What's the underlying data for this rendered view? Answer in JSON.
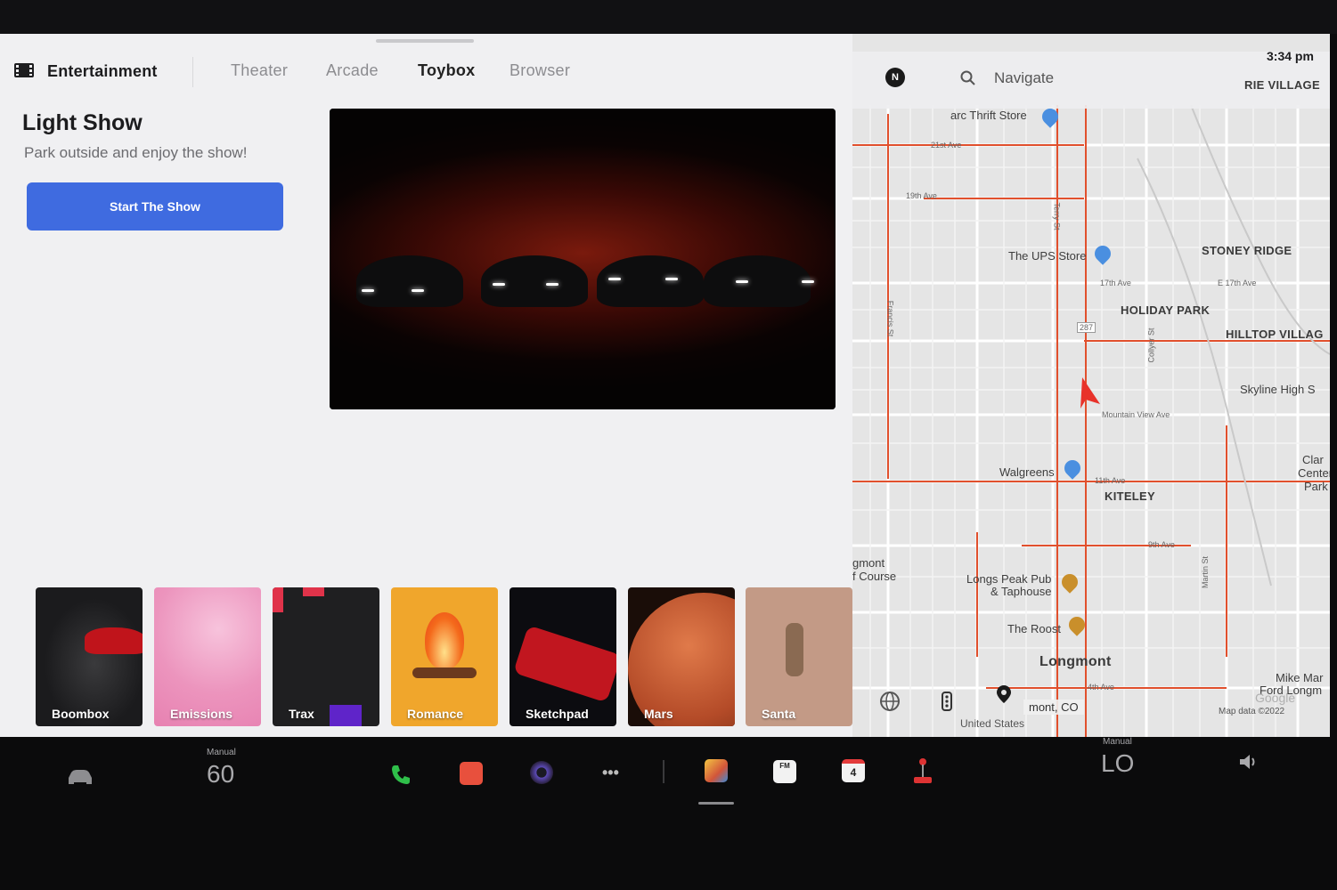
{
  "header": {
    "app_title": "Entertainment",
    "tabs": [
      {
        "label": "Theater",
        "active": false
      },
      {
        "label": "Arcade",
        "active": false
      },
      {
        "label": "Toybox",
        "active": true
      },
      {
        "label": "Browser",
        "active": false
      }
    ]
  },
  "feature": {
    "title": "Light Show",
    "subtitle": "Park outside and enjoy the show!",
    "button_label": "Start The Show"
  },
  "tiles": [
    {
      "label": "Boombox",
      "color": "#1b1b1d"
    },
    {
      "label": "Emissions",
      "color": "#f09cc0"
    },
    {
      "label": "Trax",
      "color": "#222224"
    },
    {
      "label": "Romance",
      "color": "#f2a82a"
    },
    {
      "label": "Sketchpad",
      "color": "#0c0c10"
    },
    {
      "label": "Mars",
      "color": "#3a1a12"
    },
    {
      "label": "Santa",
      "color": "#c59a85"
    }
  ],
  "map": {
    "compass_label": "N",
    "search_placeholder": "Navigate",
    "time": "3:34 pm",
    "places": {
      "prairie_village": "RIE VILLAGE",
      "stoney_ridge": "STONEY RIDGE",
      "holiday_park": "HOLIDAY PARK",
      "hilltop_village": "HILLTOP VILLAG",
      "kiteley": "KITELEY",
      "longmont": "Longmont"
    },
    "pois": {
      "thrift": "arc Thrift Store",
      "ups": "The UPS Store",
      "skyline": "Skyline High S",
      "walgreens": "Walgreens",
      "longs_peak_1": "Longs Peak Pub",
      "longs_peak_2": "& Taphouse",
      "roost": "The Roost",
      "golf_1": "gmont",
      "golf_2": "f Course",
      "clark_1": "Clar",
      "clark_2": "Center",
      "clark_3": "Park",
      "mike_1": "Mike Mar",
      "mike_2": "Ford Longm"
    },
    "streets": {
      "s21": "21st Ave",
      "s19": "19th Ave",
      "s17": "17th Ave",
      "e17": "E 17th Ave",
      "mountain_view": "Mountain View Ave",
      "s11": "11th Ave",
      "s9": "9th Ave",
      "s4": "4th Ave",
      "terry": "Terry St",
      "francis": "Francis St",
      "collyer": "Collyer St",
      "martin": "Martin St",
      "hwy": "287"
    },
    "location_chip": "mont, CO",
    "country": "United States",
    "attribution": "Map data ©2022",
    "google": "Google"
  },
  "taskbar": {
    "left_mode": "Manual",
    "left_temp": "60",
    "right_mode": "Manual",
    "right_temp": "LO",
    "calendar_day": "4",
    "fm_label": "FM"
  }
}
